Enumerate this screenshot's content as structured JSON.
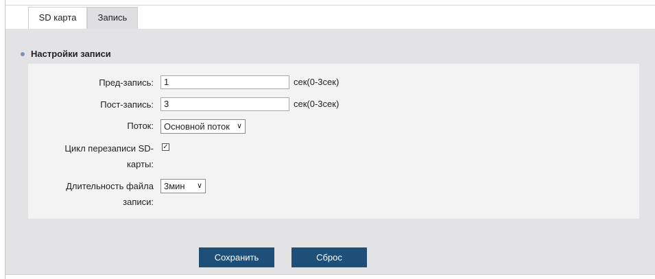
{
  "tabs": [
    {
      "label": "SD карта",
      "active": false
    },
    {
      "label": "Запись",
      "active": true
    }
  ],
  "section": {
    "title": "Настройки записи"
  },
  "form": {
    "pre_record": {
      "label": "Пред-запись:",
      "value": "1",
      "unit": "сек(0-3сек)"
    },
    "post_record": {
      "label": "Пост-запись:",
      "value": "3",
      "unit": "сек(0-3сек)"
    },
    "stream": {
      "label": "Поток:",
      "selected": "Основной поток"
    },
    "overwrite": {
      "label_line1": "Цикл перезаписи SD-",
      "label_line2": "карты:",
      "checked": true,
      "check_glyph": "✓"
    },
    "file_length": {
      "label_line1": "Длительность файла",
      "label_line2": "записи:",
      "selected": "3мин"
    }
  },
  "buttons": {
    "save": "Сохранить",
    "reset": "Сброс"
  },
  "colors": {
    "accent": "#1e4f78",
    "content_bg": "#e3e3e6",
    "panel_bg": "#f3f3f3"
  }
}
